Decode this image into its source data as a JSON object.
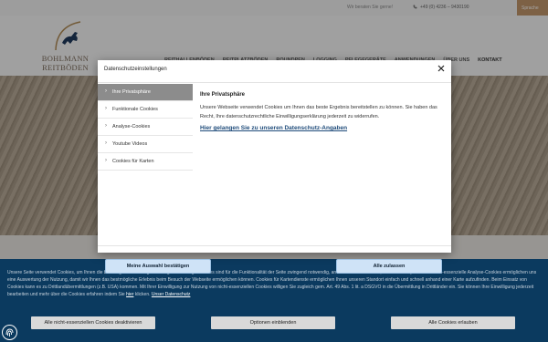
{
  "topbar": {
    "consult": "Wir beraten Sie gerne!",
    "phone": "+49 (0) 4236 – 9430190",
    "language": "Sprache"
  },
  "header": {
    "logo_line1": "BOHLMANN",
    "logo_line2": "REITBÖDEN",
    "nav": [
      "REITHALLENBÖDEN",
      "REITPLATZBÖDEN",
      "ROUNDPEN",
      "LOGGING",
      "PFLEGEGERÄTE",
      "ANWENDUNGEN",
      "ÜBER UNS"
    ],
    "nav_contact": "KONTAKT"
  },
  "modal": {
    "title": "Datenschutzeinstellungen",
    "tabs": [
      {
        "label": "Ihre Privatsphäre",
        "active": true
      },
      {
        "label": "Funktionale Cookies",
        "active": false
      },
      {
        "label": "Analyse-Cookies",
        "active": false
      },
      {
        "label": "Youtube Videos",
        "active": false
      },
      {
        "label": "Cookies für Karten",
        "active": false
      }
    ],
    "pane_title": "Ihre Privatsphäre",
    "pane_text": "Unsere Webseite verwendet Cookies um Ihnen das beste Ergebnis bereitstellen zu können. Sie haben das Recht, Ihre datenschutzrechtliche Einwilligungserklärung jederzeit zu widerrufen.",
    "pane_link": "Hier gelangen Sie zu unseren Datenschutz-Angaben",
    "confirm_button": "Meine Auswahl bestätigen",
    "accept_all_button": "Alle zulassen"
  },
  "cookiebar": {
    "text": "Unsere Seite verwendet Cookies, um Ihnen die bestmögliche Nutzung zu ermöglichen. Einige Cookies sind für die Funktionalität der Seite zwingend notwendig, andere helfen uns dabei, die Seite zu optimieren. Nicht-essenzielle Analyse-Cookies ermöglichen uns eine Auswertung der Nutzung, damit wir Ihnen das bestmögliche Erlebnis beim Besuch der Webseite ermöglichen können. Cookies für Kartendienste ermöglichen Ihnen unseren Standort einfach und schnell anhand einer Karte aufzufinden. Beim Einsatz von Cookies kann es zu Drittlandübermittlungen (z.B. USA) kommen. Mit Ihrer Einwilligung zur Nutzung von nicht-essenziellen Cookies willigen Sie zugleich gem. Art. 49 Abs. 1 lit. a DSGVO in die Übermittlung in Drittländer ein. Sie können Ihre Einwilligung jederzeit bearbeiten und mehr über die Cookies erfahren indem Sie",
    "here_link": "hier",
    "text_end": "klicken.",
    "privacy_link": "Unser Datenschutz",
    "btn_deny": "Alle nicht-essenziellen Cookies deaktivieren",
    "btn_options": "Optionen einblenden",
    "btn_allow": "Alle Cookies erlauben"
  }
}
